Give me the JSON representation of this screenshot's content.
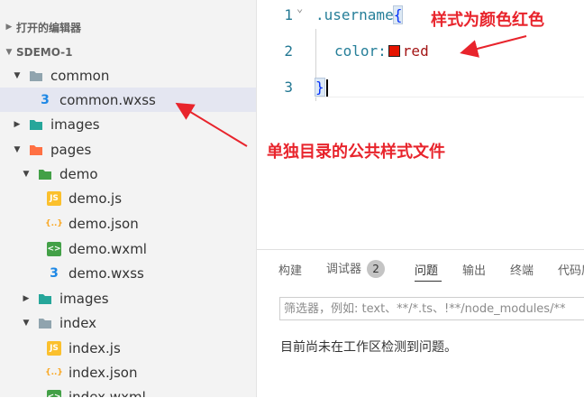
{
  "explorer": {
    "open_editors": "打开的编辑器",
    "project": "SDEMO-1",
    "items": [
      {
        "label": "common"
      },
      {
        "label": "common.wxss"
      },
      {
        "label": "images"
      },
      {
        "label": "pages"
      },
      {
        "label": "demo"
      },
      {
        "label": "demo.js"
      },
      {
        "label": "demo.json"
      },
      {
        "label": "demo.wxml"
      },
      {
        "label": "demo.wxss"
      },
      {
        "label": "images"
      },
      {
        "label": "index"
      },
      {
        "label": "index.js"
      },
      {
        "label": "index.json"
      },
      {
        "label": "index.wxml"
      }
    ]
  },
  "editor": {
    "lines": [
      "1",
      "2",
      "3"
    ],
    "selector": ".username",
    "brace_open": "{",
    "property": "color:",
    "value": "red",
    "brace_close": "}",
    "swatch_color": "#e51400"
  },
  "panel": {
    "tabs": [
      "构建",
      "调试器",
      "问题",
      "输出",
      "终端",
      "代码质"
    ],
    "debugger_count": "2",
    "filter_placeholder": "筛选器，例如: text、**/*.ts、!**/node_modules/**",
    "message": "目前尚未在工作区检测到问题。"
  },
  "annotations": {
    "style_note": "样式为颜色红色",
    "dir_note": "单独目录的公共样式文件"
  },
  "colors": {
    "accent": "#e8242c"
  }
}
